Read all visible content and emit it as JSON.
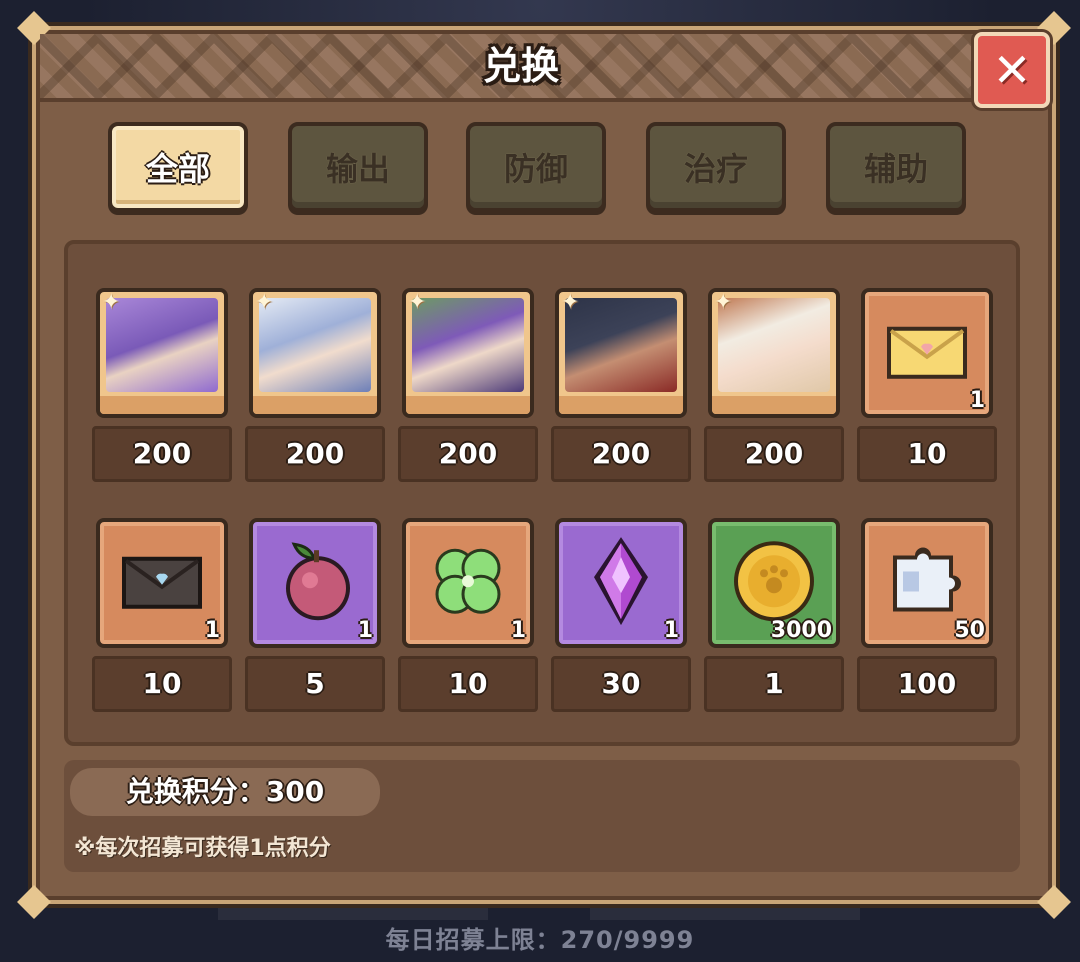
{
  "dialog": {
    "title": "兑换",
    "close_icon": "close-icon"
  },
  "tabs": [
    {
      "label": "全部",
      "active": true
    },
    {
      "label": "输出",
      "active": false
    },
    {
      "label": "防御",
      "active": false
    },
    {
      "label": "治疗",
      "active": false
    },
    {
      "label": "辅助",
      "active": false
    }
  ],
  "items": [
    {
      "kind": "hero",
      "icon": "hero-portrait-purple-hair",
      "price": "200",
      "qty": ""
    },
    {
      "kind": "hero",
      "icon": "hero-portrait-white-hair",
      "price": "200",
      "qty": ""
    },
    {
      "kind": "hero",
      "icon": "hero-portrait-purple-crown",
      "price": "200",
      "qty": ""
    },
    {
      "kind": "hero",
      "icon": "hero-portrait-dark-hat",
      "price": "200",
      "qty": ""
    },
    {
      "kind": "hero",
      "icon": "hero-portrait-blonde",
      "price": "200",
      "qty": ""
    },
    {
      "kind": "item",
      "icon": "yellow-letter-icon",
      "price": "10",
      "qty": "1"
    },
    {
      "kind": "item",
      "icon": "black-letter-icon",
      "price": "10",
      "qty": "1"
    },
    {
      "kind": "item",
      "icon": "fruit-icon",
      "price": "5",
      "qty": "1"
    },
    {
      "kind": "item",
      "icon": "clover-icon",
      "price": "10",
      "qty": "1"
    },
    {
      "kind": "item",
      "icon": "crystal-icon",
      "price": "30",
      "qty": "1"
    },
    {
      "kind": "item",
      "icon": "gold-coin-icon",
      "price": "1",
      "qty": "3000"
    },
    {
      "kind": "item",
      "icon": "puzzle-piece-icon",
      "price": "100",
      "qty": "50"
    }
  ],
  "points": {
    "text": "兑换积分：300"
  },
  "note": "※每次招募可获得1点积分",
  "background": {
    "daily_limit": "每日招募上限：270/9999"
  },
  "colors": {
    "panel": "#7e5e47",
    "active_tab": "#f3d9a4",
    "close": "#e05a52"
  }
}
